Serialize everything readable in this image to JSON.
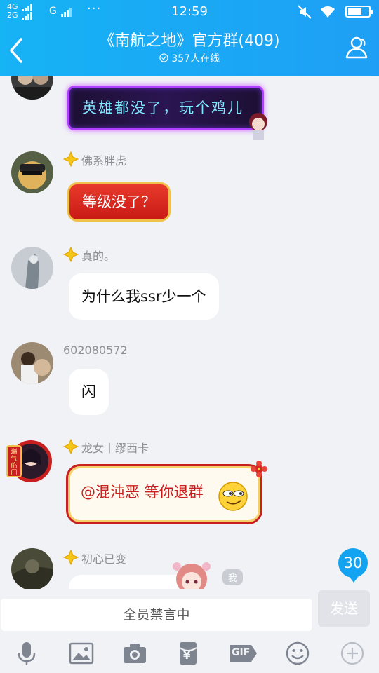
{
  "status_bar": {
    "net1": "4G",
    "net2": "2G",
    "carrier2": "G",
    "dots": "···",
    "time": "12:59"
  },
  "header": {
    "title": "《南航之地》官方群(409)",
    "online": "357人在线"
  },
  "messages": [
    {
      "nick": "",
      "text": "英雄都没了，玩个鸡儿",
      "style": "neon"
    },
    {
      "nick": "佛系胖虎",
      "text": "等级没了？",
      "style": "red"
    },
    {
      "nick": "真的。",
      "text": "为什么我ssr少一个",
      "style": "plain"
    },
    {
      "nick": "602080572",
      "text": "闪",
      "style": "plain"
    },
    {
      "nick": "龙女丨缪西卡",
      "text": "@混沌恶 等你退群",
      "style": "gold"
    },
    {
      "nick": "初心已变",
      "text": "",
      "style": "plain"
    }
  ],
  "avatar_badge_text": "瑞气临门",
  "me_tag": "我",
  "unread_count": "30",
  "input": {
    "placeholder": "全员禁言中",
    "send_label": "发送"
  },
  "toolbar": {
    "icons": [
      "microphone-icon",
      "image-icon",
      "camera-icon",
      "red-packet-icon",
      "gif-icon",
      "emoji-icon",
      "plus-icon"
    ],
    "gif_label": "GIF",
    "yen": "¥"
  },
  "colors": {
    "header_start": "#16b3f5",
    "header_end": "#1e9ff5",
    "background": "#f0f2f6",
    "badge": "#12a4f0"
  }
}
